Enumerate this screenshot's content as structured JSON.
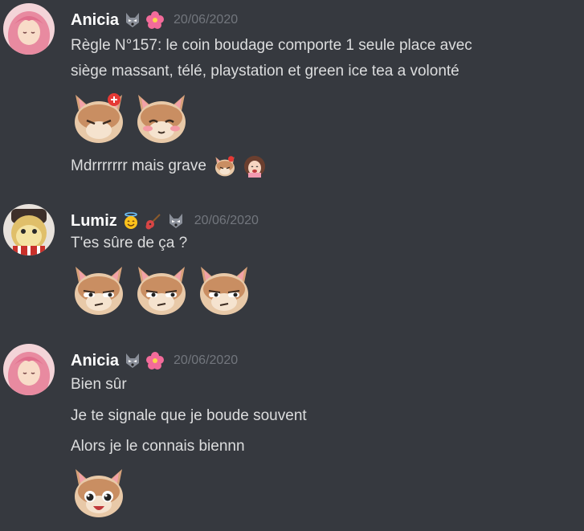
{
  "messages": [
    {
      "author": "Anicia",
      "timestamp": "20/06/2020",
      "badges": [
        "wolf-icon",
        "hibiscus-icon"
      ],
      "lines": [
        "Règle N°157: le coin boudage comporte 1 seule place avec",
        "siège massant, télé, playstation et green ice tea a volonté"
      ],
      "emotes": [
        "angry-cat-emote",
        "blushing-cat-emote"
      ],
      "followup": "Mdrrrrrrr mais grave",
      "followup_emotes": [
        "angry-cat-emote",
        "laughing-girl-emote"
      ]
    },
    {
      "author": "Lumiz",
      "timestamp": "20/06/2020",
      "badges": [
        "halo-smile-icon",
        "guitar-icon",
        "wolf-icon"
      ],
      "lines": [
        "T'es sûre de ça ?"
      ],
      "emotes": [
        "suspicious-cat-emote",
        "suspicious-cat-emote",
        "suspicious-cat-emote"
      ]
    },
    {
      "author": "Anicia",
      "timestamp": "20/06/2020",
      "badges": [
        "wolf-icon",
        "hibiscus-icon"
      ],
      "lines": [
        "Bien sûr",
        "Je te signale que je boude souvent",
        "Alors je le connais biennn"
      ],
      "emotes": [
        "happy-cat-emote"
      ]
    }
  ],
  "colors": {
    "background": "#36393f",
    "text": "#dcddde",
    "username": "#ffffff",
    "timestamp": "#72767d"
  }
}
